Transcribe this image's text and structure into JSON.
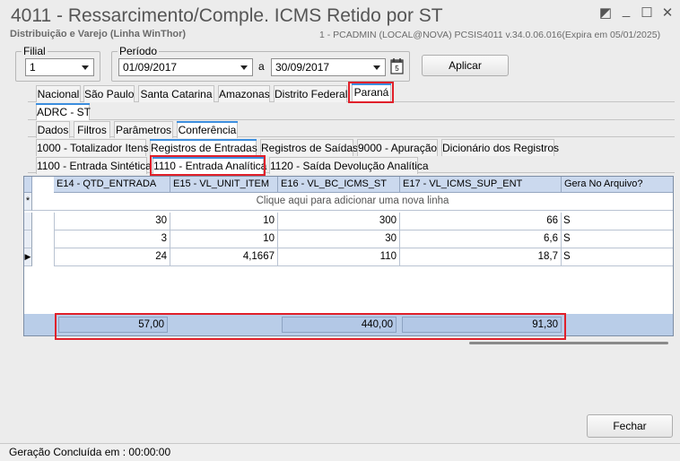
{
  "window": {
    "title": "4011 - Ressarcimento/Comple. ICMS Retido por ST",
    "subtitle": "Distribuição e Varejo (Linha WinThor)",
    "info": "1 - PCADMIN (LOCAL@NOVA)   PCSIS4011   v.34.0.06.016(Expira em 05/01/2025)"
  },
  "filters": {
    "filial_label": "Filial",
    "filial_value": "1",
    "periodo_label": "Período",
    "date_from": "01/09/2017",
    "date_sep": "a",
    "date_to": "30/09/2017",
    "apply_label": "Aplicar"
  },
  "state_tabs": [
    "Nacional",
    "São Paulo",
    "Santa Catarina",
    "Amazonas",
    "Distrito Federal",
    "Paraná"
  ],
  "sub_tab": "ADRC - ST",
  "section_tabs": [
    "Dados",
    "Filtros",
    "Parâmetros",
    "Conferência"
  ],
  "register_tabs_row1": [
    "1000 - Totalizador Itens",
    "Registros de Entradas",
    "Registros de Saídas",
    "9000 - Apuração",
    "Dicionário dos Registros"
  ],
  "register_tabs_row2": [
    "1100 - Entrada Sintética",
    "1110 - Entrada Analítica",
    "1120 - Saída Devolução Analítica"
  ],
  "grid": {
    "columns": [
      "E14 - QTD_ENTRADA",
      "E15 - VL_UNIT_ITEM",
      "E16 - VL_BC_ICMS_ST",
      "E17 - VL_ICMS_SUP_ENT",
      "Gera No Arquivo?"
    ],
    "new_row_hint": "Clique aqui para adicionar uma nova linha",
    "rows": [
      [
        "30",
        "10",
        "300",
        "66",
        "S"
      ],
      [
        "3",
        "10",
        "30",
        "6,6",
        "S"
      ],
      [
        "24",
        "4,1667",
        "110",
        "18,7",
        "S"
      ]
    ],
    "totals": {
      "qtd": "57,00",
      "bc": "440,00",
      "icms": "91,30"
    }
  },
  "close_label": "Fechar",
  "status_text": "Geração Concluída em : 00:00:00"
}
